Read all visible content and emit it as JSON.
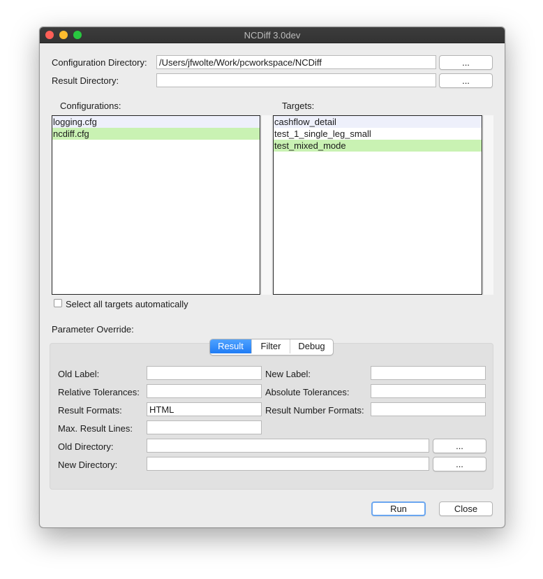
{
  "window": {
    "title": "NCDiff 3.0dev"
  },
  "directories": {
    "config_label": "Configuration Directory:",
    "config_value": "/Users/jfwolte/Work/pcworkspace/NCDiff",
    "config_browse": "...",
    "result_label": "Result Directory:",
    "result_value": "",
    "result_browse": "..."
  },
  "configurations": {
    "header": "Configurations:",
    "items": [
      "logging.cfg",
      "ncdiff.cfg"
    ],
    "selected": "ncdiff.cfg"
  },
  "targets": {
    "header": "Targets:",
    "items": [
      "cashflow_detail",
      "test_1_single_leg_small",
      "test_mixed_mode"
    ],
    "selected": "test_mixed_mode"
  },
  "select_all": {
    "label": "Select all targets automatically",
    "checked": false
  },
  "override": {
    "header": "Parameter Override:",
    "tabs": [
      "Result",
      "Filter",
      "Debug"
    ],
    "active_tab": "Result",
    "fields": {
      "old_label": {
        "label": "Old Label:",
        "value": ""
      },
      "new_label": {
        "label": "New Label:",
        "value": ""
      },
      "rel_tol": {
        "label": "Relative Tolerances:",
        "value": ""
      },
      "abs_tol": {
        "label": "Absolute Tolerances:",
        "value": ""
      },
      "result_formats": {
        "label": "Result Formats:",
        "value": "HTML"
      },
      "result_number_formats": {
        "label": "Result Number Formats:",
        "value": ""
      },
      "max_lines": {
        "label": "Max. Result Lines:",
        "value": ""
      },
      "old_dir": {
        "label": "Old Directory:",
        "value": "",
        "browse": "..."
      },
      "new_dir": {
        "label": "New Directory:",
        "value": "",
        "browse": "..."
      }
    }
  },
  "actions": {
    "run": "Run",
    "close": "Close"
  },
  "colors": {
    "selected_row": "#c9f2b3",
    "alt_row": "#eef0fb",
    "active_tab": "#1f7cf5"
  }
}
